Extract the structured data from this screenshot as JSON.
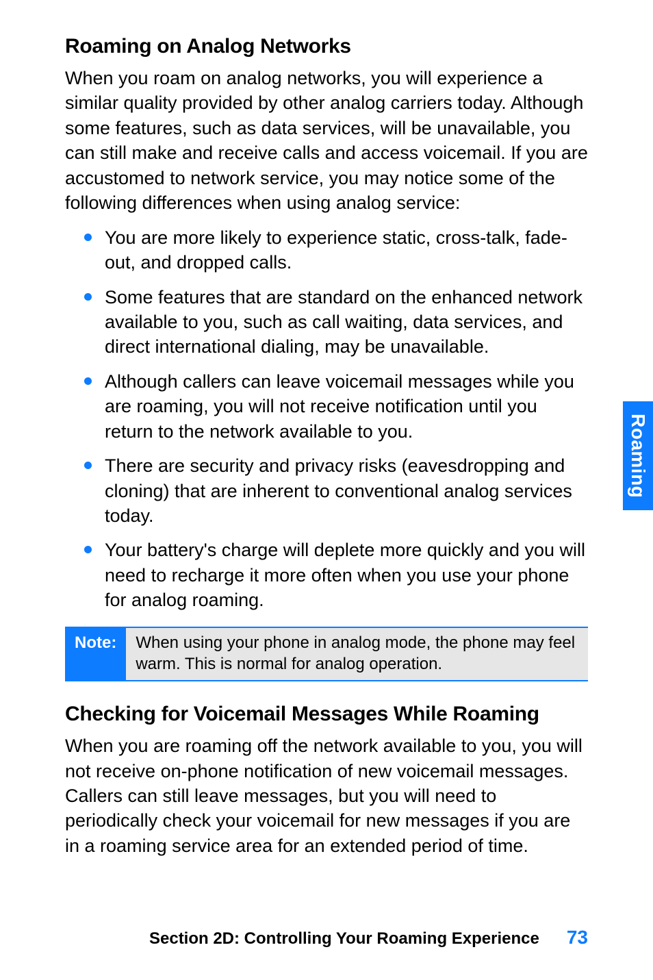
{
  "sideTab": "Roaming",
  "sections": [
    {
      "heading": "Roaming on Analog Networks",
      "intro": "When you roam on analog networks, you will experience a similar quality provided by other analog carriers today. Although some features, such as data services, will be unavailable, you can still make and receive calls and access voicemail. If you are accustomed to network service, you may notice some of the following differences when using analog service:",
      "bullets": [
        "You are more likely to experience static, cross-talk, fade-out, and dropped calls.",
        "Some features that are standard on the enhanced network available to you, such as call waiting, data services, and direct international dialing, may be unavailable.",
        "Although callers can leave voicemail messages while you are roaming, you will not receive notification until you return to the network available to you.",
        "There are security and privacy risks (eavesdropping and cloning) that are inherent to conventional analog  services today.",
        "Your battery's charge will deplete more quickly and you will need to recharge it more often when you use your phone for analog roaming."
      ]
    },
    {
      "heading": "Checking for Voicemail Messages While Roaming",
      "intro": "When you are roaming off the network available to you, you will not receive on-phone notification of new voicemail messages. Callers can still leave messages, but you will need to periodically check your voicemail for new messages if you are in a roaming service area for an extended period of time."
    }
  ],
  "note": {
    "label": "Note:",
    "body": "When using your phone in analog mode, the phone may feel warm. This is normal for analog operation."
  },
  "footer": {
    "section": "Section 2D: Controlling Your Roaming Experience",
    "page": "73"
  }
}
